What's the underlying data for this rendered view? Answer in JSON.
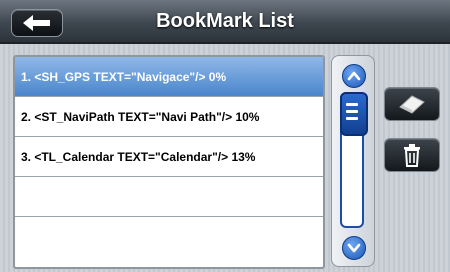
{
  "header": {
    "title": "BookMark List",
    "back_icon": "back-arrow-icon"
  },
  "bookmarks": [
    {
      "label": "1. <SH_GPS TEXT=\"Navigace\"/> 0%",
      "selected": true
    },
    {
      "label": "2. <ST_NaviPath TEXT=\"Navi Path\"/> 10%",
      "selected": false
    },
    {
      "label": "3. <TL_Calendar TEXT=\"Calendar\"/> 13%",
      "selected": false
    },
    {
      "label": "",
      "selected": false
    },
    {
      "label": "",
      "selected": false
    }
  ],
  "scroll": {
    "up_icon": "chevron-up-icon",
    "down_icon": "chevron-down-icon",
    "thumb_icon": "list-lines-icon",
    "position": 0
  },
  "actions": {
    "edit_icon": "eraser-icon",
    "delete_icon": "trash-icon"
  },
  "colors": {
    "selected_row": "#4a86cc",
    "scroll_accent": "#1d57b8",
    "header": "#3e4750"
  }
}
